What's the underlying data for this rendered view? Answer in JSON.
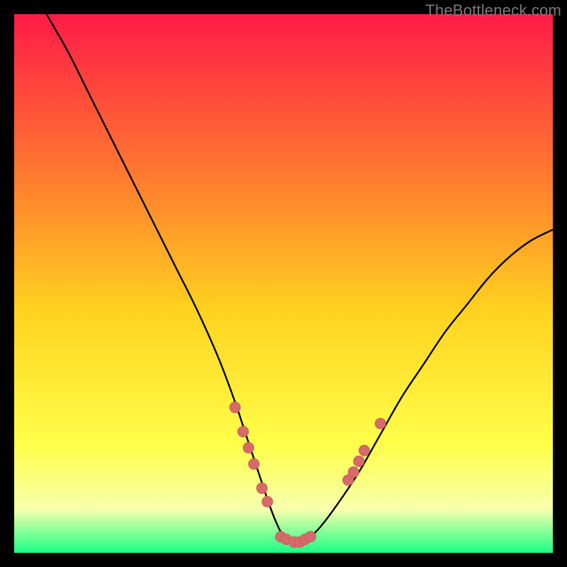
{
  "watermark": "TheBottleneck.com",
  "colors": {
    "bg": "#000000",
    "grad_top": "#ff1b47",
    "grad_upper_mid": "#ff7a2f",
    "grad_mid": "#ffd21f",
    "grad_lower_mid": "#ffff4a",
    "grad_low": "#f7ffad",
    "grad_bottom": "#19ff84",
    "curve": "#000000",
    "marker_fill": "#d76b6b",
    "marker_stroke": "#c95959"
  },
  "chart_data": {
    "type": "line",
    "title": "",
    "xlabel": "",
    "ylabel": "",
    "xlim": [
      0,
      100
    ],
    "ylim": [
      0,
      100
    ],
    "series": [
      {
        "name": "bottleneck-curve",
        "x": [
          6,
          10,
          14,
          18,
          22,
          26,
          30,
          34,
          38,
          41,
          43,
          45,
          47,
          48.5,
          50,
          51.5,
          53,
          55,
          57,
          60,
          64,
          68,
          72,
          76,
          80,
          84,
          88,
          92,
          96,
          100
        ],
        "y": [
          100,
          93,
          85,
          77,
          69,
          61,
          53,
          45,
          36,
          28,
          22,
          16,
          10,
          6,
          3,
          2,
          2,
          3,
          5,
          9,
          15,
          22,
          29,
          35,
          41,
          46,
          51,
          55,
          58,
          60
        ]
      }
    ],
    "markers": [
      {
        "x": 41.0,
        "y": 27.0
      },
      {
        "x": 42.5,
        "y": 22.5
      },
      {
        "x": 43.5,
        "y": 19.5
      },
      {
        "x": 44.5,
        "y": 16.5
      },
      {
        "x": 46.0,
        "y": 12.0
      },
      {
        "x": 47.0,
        "y": 9.5
      },
      {
        "x": 49.5,
        "y": 3.0
      },
      {
        "x": 50.5,
        "y": 2.5
      },
      {
        "x": 52.0,
        "y": 2.0
      },
      {
        "x": 53.0,
        "y": 2.0
      },
      {
        "x": 54.0,
        "y": 2.5
      },
      {
        "x": 55.0,
        "y": 3.0
      },
      {
        "x": 62.0,
        "y": 13.5
      },
      {
        "x": 63.0,
        "y": 15.0
      },
      {
        "x": 64.0,
        "y": 17.0
      },
      {
        "x": 65.0,
        "y": 19.0
      },
      {
        "x": 68.0,
        "y": 24.0
      }
    ]
  }
}
